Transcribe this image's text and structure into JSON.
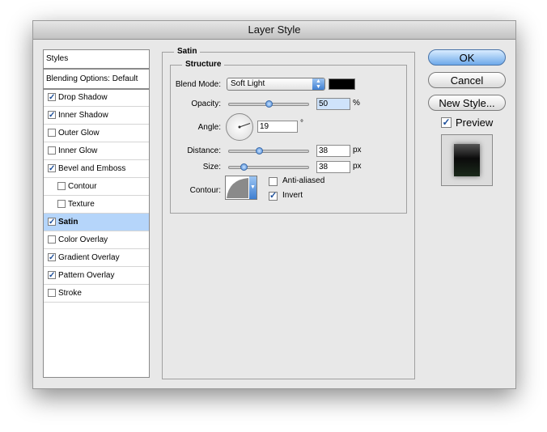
{
  "window": {
    "title": "Layer Style"
  },
  "sidebar": {
    "items": [
      {
        "label": "Styles",
        "type": "header"
      },
      {
        "label": "Blending Options: Default",
        "type": "header"
      },
      {
        "label": "Drop Shadow",
        "checked": true,
        "indent": 0
      },
      {
        "label": "Inner Shadow",
        "checked": true,
        "indent": 0
      },
      {
        "label": "Outer Glow",
        "checked": false,
        "indent": 0
      },
      {
        "label": "Inner Glow",
        "checked": false,
        "indent": 0
      },
      {
        "label": "Bevel and Emboss",
        "checked": true,
        "indent": 0
      },
      {
        "label": "Contour",
        "checked": false,
        "indent": 1
      },
      {
        "label": "Texture",
        "checked": false,
        "indent": 1
      },
      {
        "label": "Satin",
        "checked": true,
        "indent": 0,
        "selected": true
      },
      {
        "label": "Color Overlay",
        "checked": false,
        "indent": 0
      },
      {
        "label": "Gradient Overlay",
        "checked": true,
        "indent": 0
      },
      {
        "label": "Pattern Overlay",
        "checked": true,
        "indent": 0
      },
      {
        "label": "Stroke",
        "checked": false,
        "indent": 0
      }
    ]
  },
  "satin": {
    "group_title": "Satin",
    "structure_title": "Structure",
    "blend_mode_label": "Blend Mode:",
    "blend_mode_value": "Soft Light",
    "blend_color": "#000000",
    "opacity_label": "Opacity:",
    "opacity_value": "50",
    "opacity_unit": "%",
    "opacity_fraction": 0.5,
    "angle_label": "Angle:",
    "angle_value": "19",
    "angle_unit": "°",
    "distance_label": "Distance:",
    "distance_value": "38",
    "distance_unit": "px",
    "distance_fraction": 0.38,
    "size_label": "Size:",
    "size_value": "38",
    "size_unit": "px",
    "size_fraction": 0.19,
    "contour_label": "Contour:",
    "anti_aliased_label": "Anti-aliased",
    "anti_aliased_checked": false,
    "invert_label": "Invert",
    "invert_checked": true
  },
  "buttons": {
    "ok": "OK",
    "cancel": "Cancel",
    "new_style": "New Style...",
    "preview_label": "Preview",
    "preview_checked": true
  },
  "colors": {
    "accent": "#6ea9ea",
    "selected_row": "#b5d5fa"
  }
}
